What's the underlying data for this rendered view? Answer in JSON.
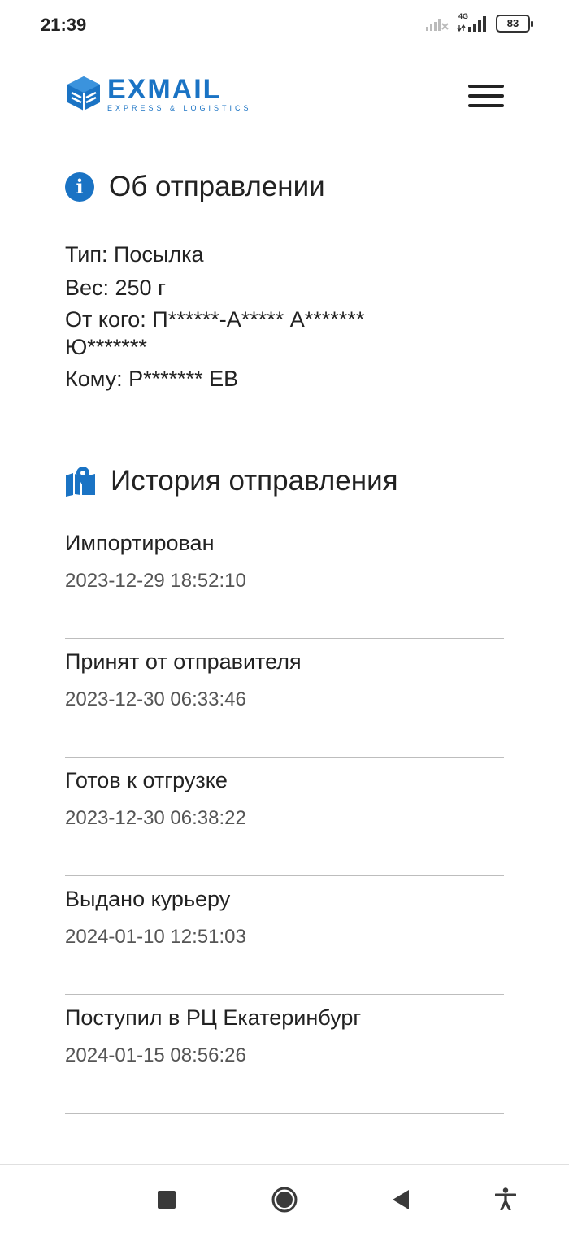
{
  "status_bar": {
    "time": "21:39",
    "network": "4G",
    "battery": "83"
  },
  "header": {
    "logo_name": "EXMAIL",
    "logo_tagline": "EXPRESS & LOGISTICS",
    "menu_icon": "hamburger-menu-icon"
  },
  "about": {
    "title": "Об отправлении",
    "icon": "info-icon",
    "type": "Тип: Посылка",
    "weight": "Вес: 250 г",
    "sender": "От кого: П******-А***** А******* Ю*******",
    "recipient": "Кому: Р******* ЕВ"
  },
  "history": {
    "title": "История отправления",
    "icon": "map-pin-icon",
    "items": [
      {
        "status": "Импортирован",
        "date": "2023-12-29 18:52:10"
      },
      {
        "status": "Принят от отправителя",
        "date": "2023-12-30 06:33:46"
      },
      {
        "status": "Готов к отгрузке",
        "date": "2023-12-30 06:38:22"
      },
      {
        "status": "Выдано курьеру",
        "date": "2024-01-10 12:51:03"
      },
      {
        "status": "Поступил в РЦ Екатеринбург",
        "date": "2024-01-15 08:56:26"
      }
    ]
  },
  "colors": {
    "brand": "#1a73c4",
    "text": "#222222",
    "muted": "#555555",
    "divider": "#bdbdbd"
  }
}
